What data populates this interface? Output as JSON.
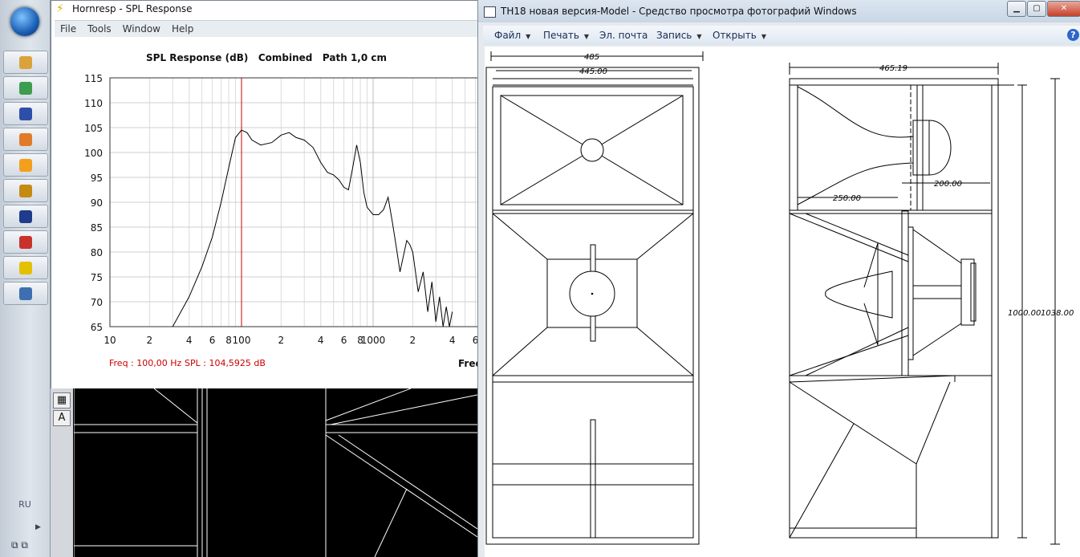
{
  "taskbar": {
    "items": [
      {
        "icon": "explorer-icon",
        "color": "#d9a33a"
      },
      {
        "icon": "chrome-icon",
        "color": "#3c9d4e"
      },
      {
        "icon": "save-disk-icon",
        "color": "#2d4fa8"
      },
      {
        "icon": "photos-icon",
        "color": "#e07b29"
      },
      {
        "icon": "media-player-icon",
        "color": "#f2a01c"
      },
      {
        "icon": "triangle-app-icon",
        "color": "#c48a12"
      },
      {
        "icon": "blue-app-icon",
        "color": "#1f3b8c"
      },
      {
        "icon": "red-app-icon",
        "color": "#c8322a"
      },
      {
        "icon": "hornresp-icon",
        "color": "#e4c000"
      },
      {
        "icon": "photo-viewer-icon",
        "color": "#3e6fb0"
      }
    ],
    "language": "RU"
  },
  "hornresp": {
    "title": "Hornresp - SPL Response",
    "menu": [
      "File",
      "Tools",
      "Window",
      "Help"
    ],
    "readout_freq": "Freq : 100,00 Hz",
    "readout_spl": "SPL : 104,5925 dB",
    "x_axis_label_partial": "Freq"
  },
  "chart_data": {
    "type": "line",
    "title": "SPL Response (dB)   Combined   Path 1,0 cm",
    "x_scale": "log",
    "xlim": [
      10,
      4000
    ],
    "ylim": [
      65,
      115
    ],
    "y_ticks": [
      115,
      110,
      105,
      100,
      95,
      90,
      85,
      80,
      75,
      70,
      65
    ],
    "x_tick_labels": [
      "10",
      "2",
      "4",
      "6",
      "8",
      "100",
      "2",
      "4",
      "6",
      "8",
      "1000",
      "2",
      "4",
      "6"
    ],
    "x_tick_values": [
      10,
      20,
      40,
      60,
      80,
      100,
      200,
      400,
      600,
      800,
      1000,
      2000,
      4000,
      6000
    ],
    "marker_x": 100,
    "marker_color": "#cc0000",
    "series": [
      {
        "x": [
          30,
          40,
          50,
          60,
          70,
          80,
          90,
          100,
          110,
          120,
          140,
          170,
          200,
          230,
          260,
          300,
          350,
          400,
          450,
          500,
          550,
          600,
          650,
          700,
          750,
          800,
          850,
          900,
          1000,
          1100,
          1200,
          1300,
          1400,
          1500,
          1600,
          1800,
          1900,
          2000,
          2200,
          2400,
          2600,
          2800,
          3000,
          3200,
          3400,
          3600,
          3800,
          4000
        ],
        "y": [
          65,
          71,
          77,
          83,
          90,
          97,
          103,
          104.5,
          104,
          102.5,
          101.5,
          102,
          103.5,
          104,
          103,
          102.5,
          101,
          98,
          96,
          95.5,
          94.5,
          93,
          92.5,
          97,
          101.5,
          98,
          92,
          89,
          87.5,
          87.5,
          88.5,
          91,
          86,
          81,
          76,
          82.3,
          81.5,
          80,
          72,
          76,
          68,
          74,
          66,
          71,
          64,
          69,
          63,
          68
        ]
      }
    ]
  },
  "viewer": {
    "title": "TH18 новая версия-Model - Средство просмотра фотографий Windows",
    "menu": [
      "Файл",
      "Печать",
      "Эл. почта",
      "Запись",
      "Открыть"
    ],
    "menu_has_dropdown": [
      true,
      true,
      false,
      true,
      true
    ],
    "window_buttons": [
      "minimize",
      "maximize",
      "close"
    ]
  },
  "drawing": {
    "dim_width_outer": "485",
    "dim_width_inner": "445.00",
    "dim_depth": "465.19",
    "dim_250": "250.00",
    "dim_200": "200.00",
    "dim_height_1": "1000.00",
    "dim_height_2": "1038.00"
  },
  "cad": {
    "tools": [
      "table-icon",
      "text-A-icon"
    ],
    "text_tool_glyph": "A"
  }
}
